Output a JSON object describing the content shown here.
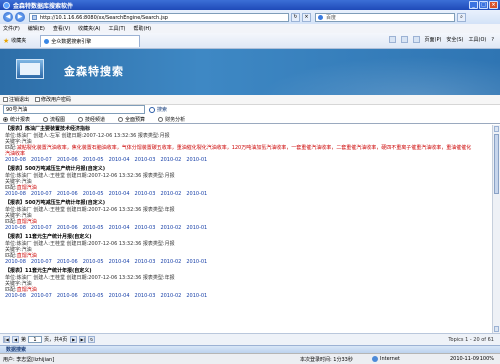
{
  "window": {
    "title": "金森特数据库搜索软件"
  },
  "browser": {
    "address": "http://10.1.16.66:8080/xx/SearchEngine/Search.jsp",
    "search_placeholder": "百度",
    "menu": [
      "文件(F)",
      "编辑(E)",
      "查看(V)",
      "收藏夹(A)",
      "工具(T)",
      "帮助(H)"
    ],
    "favorites_label": "收藏夹",
    "tab_title": "全众数据搜索引擎",
    "tab_tools": [
      "页面(P)",
      "安全(S)",
      "工具(O)"
    ]
  },
  "banner": {
    "brand": "金森特搜索"
  },
  "userbar": {
    "logout": "注销退出",
    "change_password": "修改用户密码"
  },
  "query": {
    "value": "90号汽油",
    "search_button": "搜索"
  },
  "categories": [
    {
      "label": "统计报表",
      "selected": true
    },
    {
      "label": "流程图",
      "selected": false
    },
    {
      "label": "技经频道",
      "selected": false
    },
    {
      "label": "全面预算",
      "selected": false
    },
    {
      "label": "财务分析",
      "selected": false
    }
  ],
  "results": [
    {
      "title": "【报表】炼油厂主要装置技术经济指标",
      "meta": "单位:炼油厂  创建人:左军  创建日期:2007-12-06 13:32:36 报表类型:月报",
      "keywords": "关键字:汽油",
      "match_prefix": "匹配:",
      "match_red": "减粘裂化装置汽油收率，焦化装置石脑油收率，气体分馏装置碳五收率，重油催化裂化汽油收率，120万吨油加氢汽油收率，一套重催汽油收率，二套重催汽油收率，硬四不重离子催重汽油收率，重油催催化汽油收率",
      "dates": [
        "2010-08",
        "2010-07",
        "2010-06",
        "2010-05",
        "2010-04",
        "2010-03",
        "2010-02",
        "2010-01"
      ]
    },
    {
      "title": "【报表】500万吨减压生产统计月报(自定义)",
      "meta": "单位:炼油厂  创建人:王桂堂  创建日期:2007-12-06 13:32:36 报表类型:月报",
      "keywords": "关键字:汽油",
      "match_prefix": "匹配:",
      "match_red": "直馏汽油",
      "dates": [
        "2010-08",
        "2010-07",
        "2010-06",
        "2010-05",
        "2010-04",
        "2010-03",
        "2010-02",
        "2010-01"
      ]
    },
    {
      "title": "【报表】500万吨减压生产统计年报(自定义)",
      "meta": "单位:炼油厂  创建人:王桂堂  创建日期:2007-12-06 13:32:36 报表类型:年报",
      "keywords": "关键字:汽油",
      "match_prefix": "匹配:",
      "match_red": "直馏汽油",
      "dates": [
        "2010-08",
        "2010-07",
        "2010-06",
        "2010-05",
        "2010-04",
        "2010-03",
        "2010-02",
        "2010-01"
      ]
    },
    {
      "title": "【报表】11套元生产统计月报(自定义)",
      "meta": "单位:炼油厂  创建人:王桂堂  创建日期:2007-12-06 13:32:36 报表类型:月报",
      "keywords": "关键字:汽油",
      "match_prefix": "匹配:",
      "match_red": "直馏汽油",
      "dates": [
        "2010-08",
        "2010-07",
        "2010-06",
        "2010-05",
        "2010-04",
        "2010-03",
        "2010-02",
        "2010-01"
      ]
    },
    {
      "title": "【报表】11套元生产统计年报(自定义)",
      "meta": "单位:炼油厂  创建人:王桂堂  创建日期:2007-12-06 13:32:36 报表类型:年报",
      "keywords": "关键字:汽油",
      "match_prefix": "匹配:",
      "match_red": "直馏汽油",
      "dates": [
        "2010-08",
        "2010-07",
        "2010-06",
        "2010-05",
        "2010-04",
        "2010-03",
        "2010-02",
        "2010-01"
      ]
    }
  ],
  "pager": {
    "page_label": "第",
    "page_value": "1",
    "page_total": "页，共4页",
    "summary": "Topics 1 - 20 of 61"
  },
  "footer": {
    "label": "数据搜索"
  },
  "status": {
    "user": "用户: 李志坚[lizhijian]",
    "last_login": "本次登录时间: 1分33秒",
    "zone": "Internet",
    "date": "2010-11-09",
    "zoom": "100%"
  }
}
